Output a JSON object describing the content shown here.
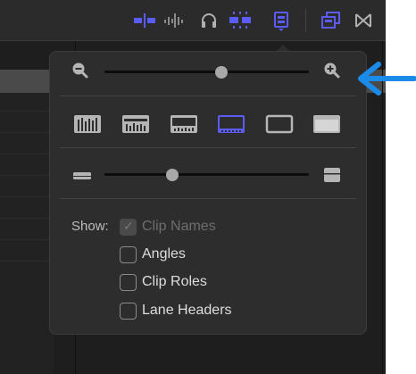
{
  "toolbar": {
    "icons": [
      "skimming-icon",
      "audio-skimming-icon",
      "headphones-icon",
      "snapping-icon",
      "clip-appearance-icon",
      "inspector-icon",
      "transitions-icon"
    ]
  },
  "zoom": {
    "zoom_out_icon": "zoom-out-icon",
    "zoom_in_icon": "zoom-in-icon",
    "level": 0.57
  },
  "appearance": {
    "options": [
      "waveform-large",
      "waveform-filmstrip-small",
      "waveform-filmstrip-medium",
      "filmstrip-large",
      "filmstrip-only",
      "name-only"
    ],
    "selected_index": 3
  },
  "clip_height": {
    "min_icon": "clip-height-small-icon",
    "max_icon": "clip-height-large-icon",
    "level": 0.33
  },
  "show": {
    "label": "Show:",
    "options": [
      {
        "label": "Clip Names",
        "checked": true,
        "disabled": true
      },
      {
        "label": "Angles",
        "checked": false,
        "disabled": false
      },
      {
        "label": "Clip Roles",
        "checked": false,
        "disabled": false
      },
      {
        "label": "Lane Headers",
        "checked": false,
        "disabled": false
      }
    ]
  },
  "colors": {
    "accent": "#5b5bf5",
    "annotation_arrow": "#1a8be8",
    "popover_bg": "#2d2d2d"
  }
}
